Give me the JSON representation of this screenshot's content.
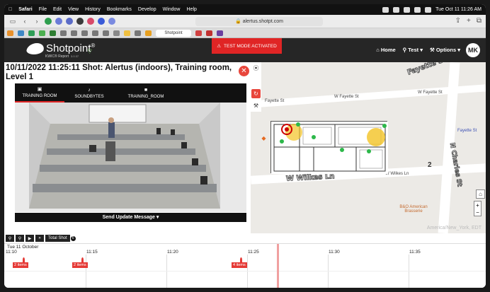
{
  "menubar": {
    "items": [
      "Safari",
      "File",
      "Edit",
      "View",
      "History",
      "Bookmarks",
      "Develop",
      "Window",
      "Help"
    ],
    "clock": "Tue Oct 11  11:26 AM"
  },
  "browser": {
    "url": "alertus.shotpt.com",
    "active_tab": "Shotpoint"
  },
  "header": {
    "logo_name": "Shotpoint",
    "logo_reg": "®",
    "logo_sub": "KWIC® Report",
    "logo_ver": "3.0.37",
    "test_banner": "TEST MODE ACTIVATED",
    "nav": {
      "home": "Home",
      "test": "Test ▾",
      "options": "Options ▾"
    },
    "avatar": "MK"
  },
  "shot": {
    "title": "10/11/2022 11:25:11 Shot: Alertus (indoors), Training room, Level 1",
    "tabs": [
      "TRAINING ROOM",
      "SOUNDBYTES",
      "TRAINING_ROOM"
    ],
    "send_label": "Send Update Message ▾"
  },
  "map": {
    "street_fayette_1": "Fayette St",
    "street_fayette_2": "W Fayette St",
    "street_fayette_3": "W Fayette St",
    "street_wilkes": "W Wilkes Ln",
    "street_wilkes_small": "W Wilkes Ln",
    "street_charles": "N Charles St",
    "shield_fayette": "Fayette St",
    "shield_wilkes": "W Wilkes Ln",
    "shield_charles": "N Charles St",
    "poi": "B&O American Brasserie",
    "poi_fayette": "Fayette St",
    "num_2": "2",
    "timezone": "America/New_York, EDT"
  },
  "timeline": {
    "controls": [
      "Q",
      "Q",
      "▶",
      "▶▶"
    ],
    "total_label": "Total Shot",
    "total_count": "6",
    "date": "Tue 11 October",
    "ticks": [
      "11:10",
      "11:15",
      "11:20",
      "11:25",
      "11:30",
      "11:35"
    ],
    "items": [
      "2 items",
      "2 items",
      "4 items"
    ]
  }
}
